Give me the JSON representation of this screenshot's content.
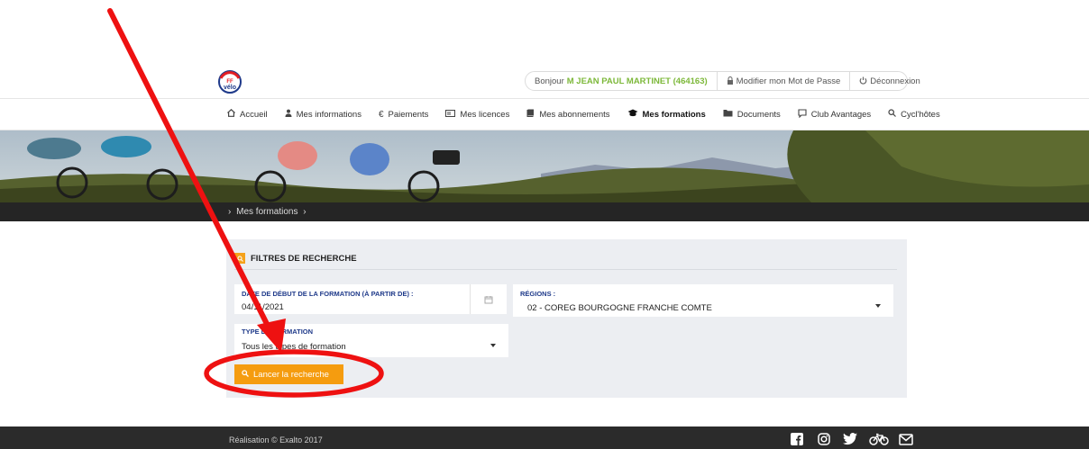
{
  "header": {
    "logo_text": "FF vélo",
    "greeting_prefix": "Bonjour",
    "user_name": "M JEAN PAUL MARTINET (464163)",
    "change_password": "Modifier mon Mot de Passe",
    "logout": "Déconnexion"
  },
  "nav": {
    "items": [
      {
        "icon": "home-icon",
        "label": "Accueil"
      },
      {
        "icon": "user-icon",
        "label": "Mes informations"
      },
      {
        "icon": "euro-icon",
        "label": "Paiements"
      },
      {
        "icon": "id-card-icon",
        "label": "Mes licences"
      },
      {
        "icon": "book-icon",
        "label": "Mes abonnements"
      },
      {
        "icon": "graduation-cap-icon",
        "label": "Mes formations",
        "active": true
      },
      {
        "icon": "folder-icon",
        "label": "Documents"
      },
      {
        "icon": "chat-icon",
        "label": "Club Avantages"
      },
      {
        "icon": "search-icon",
        "label": "Cycl'hôtes"
      }
    ]
  },
  "breadcrumb": {
    "items": [
      "Mes formations"
    ]
  },
  "filters": {
    "title": "FILTRES DE RECHERCHE",
    "date_label": "DATE DE DÉBUT DE LA FORMATION (À PARTIR DE) :",
    "date_value": "04/11/2021",
    "region_label": "RÉGIONS :",
    "region_value": "02 - COREG BOURGOGNE FRANCHE COMTE",
    "type_label": "TYPE DE FORMATION",
    "type_value": "Tous les types de formation",
    "search_button": "Lancer la recherche"
  },
  "footer": {
    "credit": "Réalisation © Exalto 2017",
    "social_icons": [
      "facebook-icon",
      "instagram-icon",
      "twitter-icon",
      "bicycle-icon",
      "mail-icon"
    ]
  },
  "colors": {
    "accent": "#f59c0f",
    "green": "#7db83a",
    "label_blue": "#1f3a8a",
    "annotation_red": "#ee1111"
  }
}
